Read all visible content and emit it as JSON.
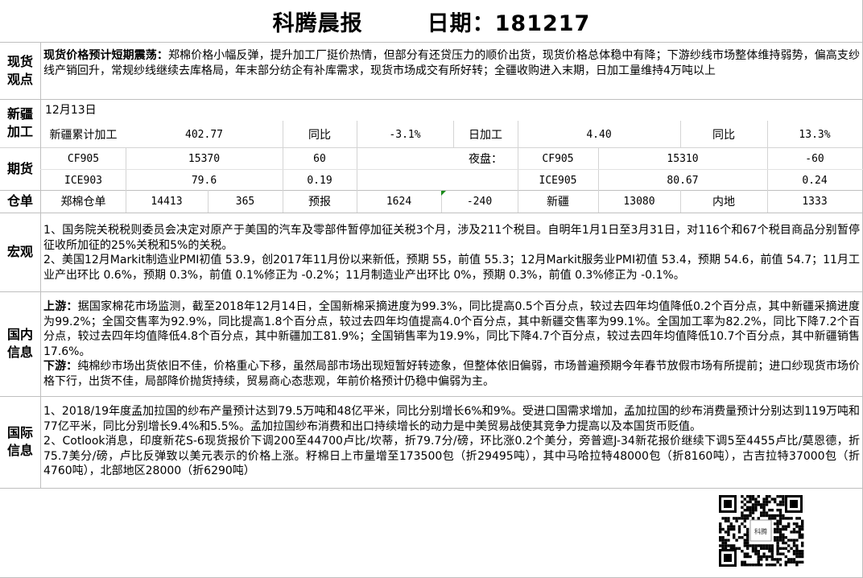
{
  "header": {
    "name": "科腾晨报",
    "date_label": "日期：181217"
  },
  "sections": {
    "spot": "现货\n观点",
    "xinjiang": "新疆\n加工",
    "futures": "期货",
    "warehouse": "仓单",
    "macro": "宏观",
    "domestic": "国内\n信息",
    "international": "国际\n信息"
  },
  "spot_view": {
    "lead": "现货价格预计短期震荡：",
    "text": "郑棉价格小幅反弹，提升加工厂挺价热情，但部分有还贷压力的顺价出货，现货价格总体稳中有降；下游纱线市场整体维持弱势，偏高支纱线产销回升，常规纱线继续去库格局，年末部分纺企有补库需求，现货市场成交有所好转；全疆收购进入末期，日加工量维持4万吨以上"
  },
  "xinjiang_processing": {
    "date": "12月13日",
    "cumulative_label": "新疆累计加工",
    "cumulative_value": "402.77",
    "yoy_label": "同比",
    "cumulative_yoy": "-3.1%",
    "daily_label": "日加工",
    "daily_value": "4.40",
    "yoy_label_2": "同比",
    "daily_yoy": "13.3%"
  },
  "futures": {
    "row1": {
      "contract": "CF905",
      "price": "15370",
      "change": "60",
      "night_label": "夜盘：",
      "night_contract": "CF905",
      "night_price": "15310",
      "night_change": "-60"
    },
    "row2": {
      "contract": "ICE903",
      "price": "79.6",
      "change": "0.19",
      "contract2": "ICE905",
      "price2": "80.67",
      "change2": "0.24"
    }
  },
  "warehouse": {
    "label": "郑棉仓单",
    "value": "14413",
    "change": "365",
    "forecast_label": "预报",
    "forecast_value": "1624",
    "forecast_change": "-240",
    "xinjiang_label": "新疆",
    "xinjiang_value": "13080",
    "inland_label": "内地",
    "inland_value": "1333"
  },
  "macro": {
    "p1": "1、国务院关税税则委员会决定对原产于美国的汽车及零部件暂停加征关税3个月，涉及211个税目。自明年1月1日至3月31日，对116个和67个税目商品分别暂停征收所加征的25%关税和5%的关税。",
    "p2": "2、美国12月Markit制造业PMI初值 53.9，创2017年11月份以来新低，预期 55，前值 55.3；12月Markit服务业PMI初值 53.4，预期 54.6，前值 54.7；11月工业产出环比 0.6%，预期 0.3%，前值 0.1%修正为 -0.2%；11月制造业产出环比 0%，预期 0.3%，前值 0.3%修正为 -0.1%。"
  },
  "domestic": {
    "up_label": "上游：",
    "up_text": "据国家棉花市场监测，截至2018年12月14日，全国新棉采摘进度为99.3%，同比提高0.5个百分点，较过去四年均值降低0.2个百分点，其中新疆采摘进度为99.2%；全国交售率为92.9%，同比提高1.8个百分点，较过去四年均值提高4.0个百分点，其中新疆交售率为99.1%。全国加工率为82.2%，同比下降7.2个百分点，较过去四年均值降低4.8个百分点，其中新疆加工81.9%；全国销售率为19.9%，同比下降4.7个百分点，较过去四年均值降低10.7个百分点，其中新疆销售17.6%。",
    "down_label": "下游：",
    "down_text": "纯棉纱市场出货依旧不佳，价格重心下移，虽然局部市场出现短暂好转迹象，但整体依旧偏弱，市场普遍预期今年春节放假市场有所提前；进口纱现货市场价格下行，出货不佳，局部降价抛货持续，贸易商心态悲观，年前价格预计仍稳中偏弱为主。"
  },
  "international": {
    "p1": "1、2018/19年度孟加拉国的纱布产量预计达到79.5万吨和48亿平米，同比分别增长6%和9%。受进口国需求增加，孟加拉国的纱布消费量预计分别达到119万吨和77亿平米，同比分别增长9.4%和5.5%。孟加拉国纱布消费和出口持续增长的动力是中美贸易战使其竞争力提高以及本国货币贬值。",
    "p2": "2、Cotlook消息，印度新花S-6现货报价下调200至44700卢比/坎蒂，折79.7分/磅，环比涨0.2个美分，旁普遮J-34新花报价继续下调5至4455卢比/莫恩德，折75.7美分/磅，卢比反弹致以美元表示的价格上涨。籽棉日上市量增至173500包（折29495吨），其中马哈拉特48000包（折8160吨），古吉拉特37000包（折4760吨），北部地区28000（折6290吨）"
  },
  "qr": {
    "caption": "科腾"
  }
}
